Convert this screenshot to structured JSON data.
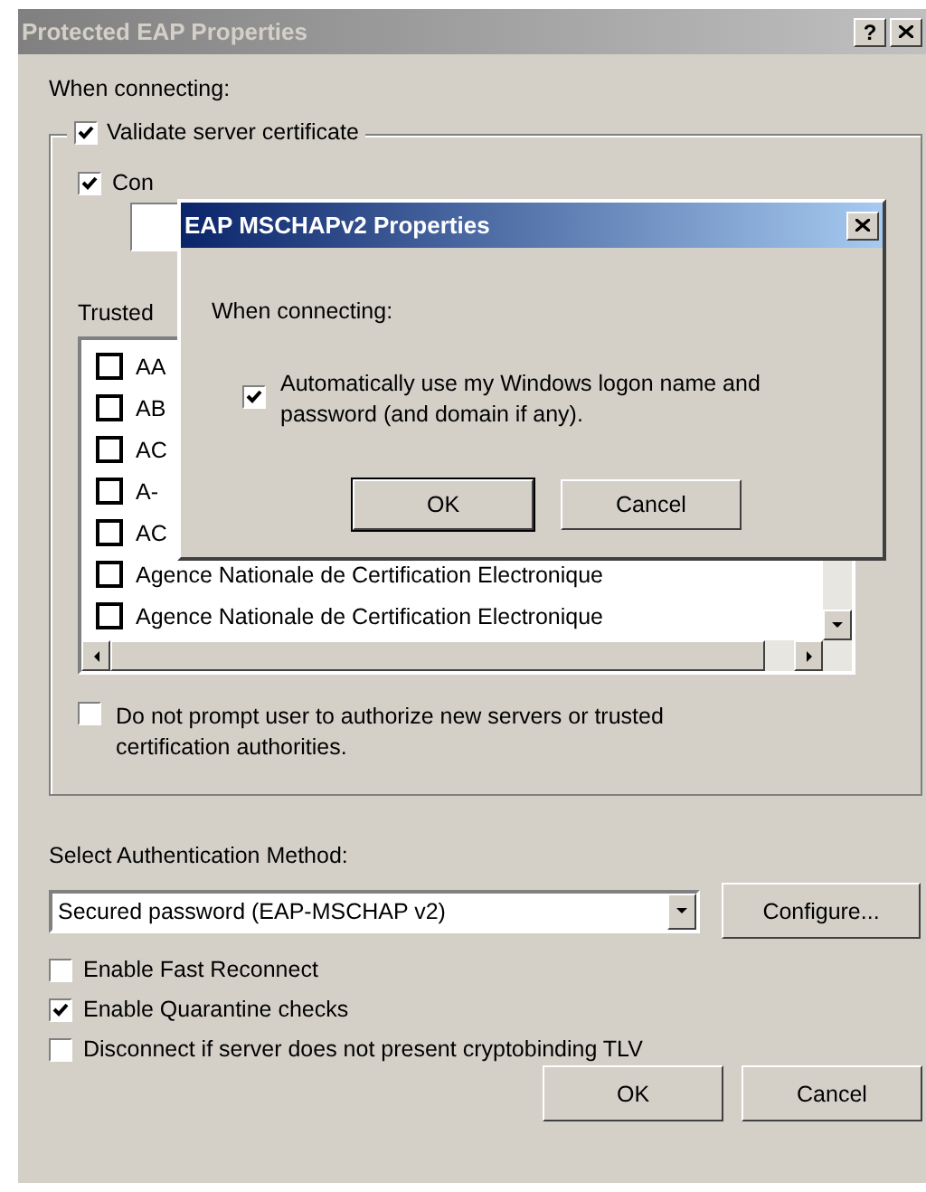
{
  "window": {
    "title": "Protected EAP Properties",
    "help": "?"
  },
  "when_connecting": "When connecting:",
  "validate": {
    "label": "Validate server certificate",
    "checked": true
  },
  "connect": {
    "label": "Con",
    "checked": true
  },
  "trusted_label": "Trusted",
  "ca_list": [
    {
      "label": "AA",
      "checked": false
    },
    {
      "label": "AB",
      "checked": false
    },
    {
      "label": "AC",
      "checked": false
    },
    {
      "label": "A-",
      "checked": false
    },
    {
      "label": "AC",
      "checked": false
    },
    {
      "label": "Agence Nationale de Certification Electronique",
      "checked": false
    },
    {
      "label": "Agence Nationale de Certification Electronique",
      "checked": false
    }
  ],
  "no_prompt": {
    "label": "Do not prompt user to authorize new servers or trusted certification authorities.",
    "checked": false
  },
  "auth_label": "Select Authentication Method:",
  "auth_method": {
    "value": "Secured password (EAP-MSCHAP v2)"
  },
  "configure": "Configure...",
  "options": [
    {
      "label": "Enable Fast Reconnect",
      "checked": false
    },
    {
      "label": "Enable Quarantine checks",
      "checked": true
    },
    {
      "label": "Disconnect if server does not present cryptobinding TLV",
      "checked": false
    }
  ],
  "buttons": [
    "OK",
    "Cancel"
  ],
  "dialog": {
    "title": "EAP MSCHAPv2 Properties",
    "when_connecting": "When connecting:",
    "auto_logon": {
      "label": "Automatically use my Windows logon name and password (and domain if any).",
      "checked": true
    },
    "buttons": [
      "OK",
      "Cancel"
    ]
  }
}
